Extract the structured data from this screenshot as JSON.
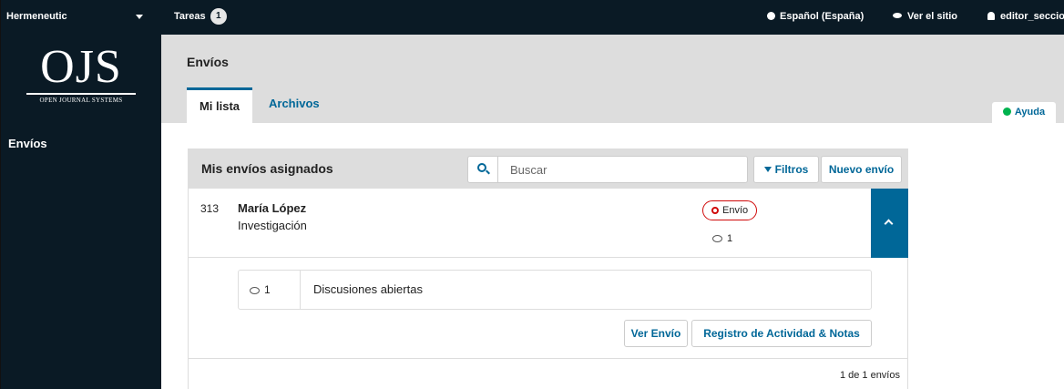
{
  "topbar": {
    "context": "Hermeneutic",
    "tasks_label": "Tareas",
    "tasks_count": "1",
    "language": "Español (España)",
    "view_site": "Ver el sitio",
    "username": "editor_seccion"
  },
  "sidebar": {
    "logo_big": "OJS",
    "logo_small": "OPEN JOURNAL SYSTEMS",
    "items": [
      {
        "label": "Envíos"
      }
    ]
  },
  "header": {
    "title": "Envíos",
    "tabs": [
      {
        "label": "Mi lista"
      },
      {
        "label": "Archivos"
      }
    ],
    "help": "Ayuda"
  },
  "panel": {
    "title": "Mis envíos asignados",
    "search_placeholder": "Buscar",
    "filters_label": "Filtros",
    "new_label": "Nuevo envío",
    "rows": [
      {
        "id": "313",
        "author": "María López",
        "title": "Investigación",
        "stage": "Envío",
        "comments": "1"
      }
    ],
    "expanded": {
      "discussions_count": "1",
      "discussions_label": "Discusiones abiertas",
      "view_label": "Ver Envío",
      "log_label": "Registro de Actividad & Notas"
    },
    "pagination": "1 de 1 envíos"
  },
  "colors": {
    "topbar_bg": "#0a1a25",
    "accent": "#006798",
    "stage_border": "#d00a0a",
    "help_dot": "#00b24e"
  }
}
